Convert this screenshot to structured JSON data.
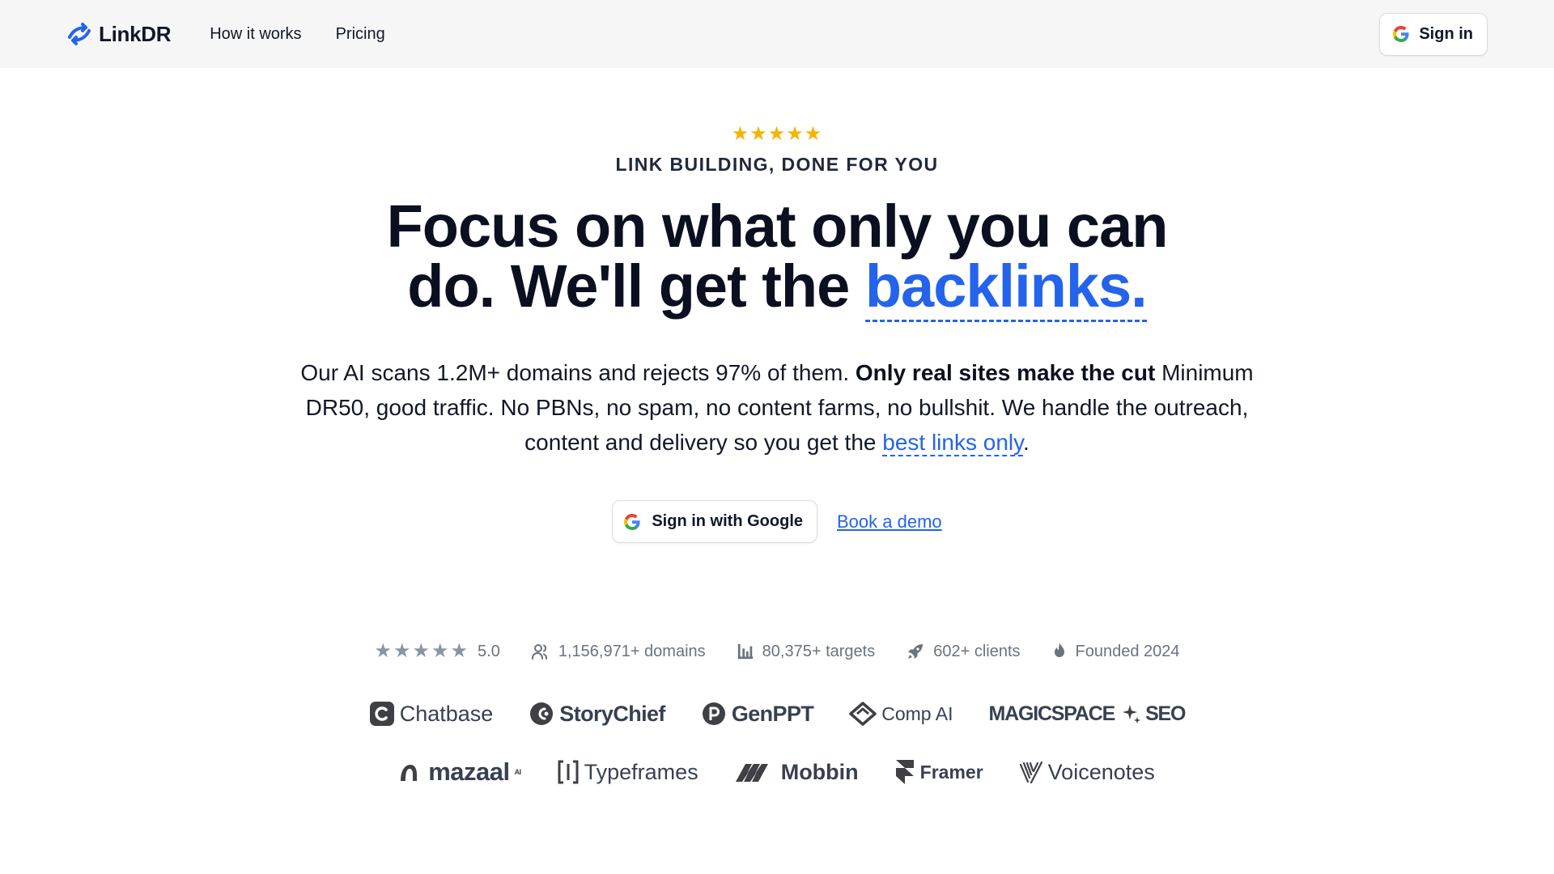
{
  "header": {
    "logo_text": "LinkDR",
    "nav": [
      "How it works",
      "Pricing"
    ],
    "signin_label": "Sign in"
  },
  "hero": {
    "stars": "★★★★★",
    "eyebrow": "LINK BUILDING, DONE FOR YOU",
    "headline_line1": "Focus on what only you can",
    "headline_line2_prefix": "do. We'll get the ",
    "headline_accent": "backlinks.",
    "copy_part1": "Our AI scans 1.2M+ domains and rejects 97% of them. ",
    "copy_bold": "Only real sites make the cut",
    "copy_part2": " Minimum DR50, good traffic. No PBNs, no spam, no content farms, no bullshit. We handle the outreach, content and delivery so you get the ",
    "copy_link": "best links only",
    "copy_end": ".",
    "google_button": "Sign in with Google",
    "demo_link": "Book a demo"
  },
  "stats": {
    "stars": "★★★★★",
    "rating": "5.0",
    "domains": "1,156,971+ domains",
    "targets": "80,375+ targets",
    "clients": "602+ clients",
    "founded": "Founded 2024"
  },
  "logos": {
    "row1": [
      "Chatbase",
      "StoryChief",
      "GenPPT",
      "Comp AI",
      "MAGICSPACE",
      "SEO"
    ],
    "row2": [
      "mazaal",
      "AI",
      "Typeframes",
      "Mobbin",
      "Framer",
      "Voicenotes"
    ]
  },
  "colors": {
    "accent": "#2463eb",
    "star": "#f5b400",
    "header_bg": "#f6f6f7",
    "text": "#0f172a",
    "muted": "#6b7280"
  },
  "icons": [
    "linkdr-logo-icon",
    "google-icon",
    "star-icon",
    "users-icon",
    "bar-chart-icon",
    "rocket-icon",
    "flame-icon"
  ]
}
